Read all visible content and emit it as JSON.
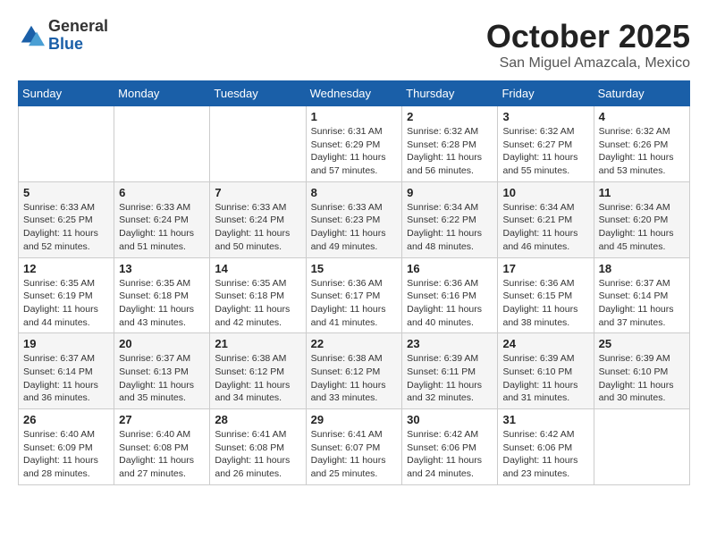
{
  "logo": {
    "general": "General",
    "blue": "Blue"
  },
  "title": "October 2025",
  "location": "San Miguel Amazcala, Mexico",
  "days_of_week": [
    "Sunday",
    "Monday",
    "Tuesday",
    "Wednesday",
    "Thursday",
    "Friday",
    "Saturday"
  ],
  "weeks": [
    [
      {
        "day": "",
        "sunrise": "",
        "sunset": "",
        "daylight": ""
      },
      {
        "day": "",
        "sunrise": "",
        "sunset": "",
        "daylight": ""
      },
      {
        "day": "",
        "sunrise": "",
        "sunset": "",
        "daylight": ""
      },
      {
        "day": "1",
        "sunrise": "Sunrise: 6:31 AM",
        "sunset": "Sunset: 6:29 PM",
        "daylight": "Daylight: 11 hours and 57 minutes."
      },
      {
        "day": "2",
        "sunrise": "Sunrise: 6:32 AM",
        "sunset": "Sunset: 6:28 PM",
        "daylight": "Daylight: 11 hours and 56 minutes."
      },
      {
        "day": "3",
        "sunrise": "Sunrise: 6:32 AM",
        "sunset": "Sunset: 6:27 PM",
        "daylight": "Daylight: 11 hours and 55 minutes."
      },
      {
        "day": "4",
        "sunrise": "Sunrise: 6:32 AM",
        "sunset": "Sunset: 6:26 PM",
        "daylight": "Daylight: 11 hours and 53 minutes."
      }
    ],
    [
      {
        "day": "5",
        "sunrise": "Sunrise: 6:33 AM",
        "sunset": "Sunset: 6:25 PM",
        "daylight": "Daylight: 11 hours and 52 minutes."
      },
      {
        "day": "6",
        "sunrise": "Sunrise: 6:33 AM",
        "sunset": "Sunset: 6:24 PM",
        "daylight": "Daylight: 11 hours and 51 minutes."
      },
      {
        "day": "7",
        "sunrise": "Sunrise: 6:33 AM",
        "sunset": "Sunset: 6:24 PM",
        "daylight": "Daylight: 11 hours and 50 minutes."
      },
      {
        "day": "8",
        "sunrise": "Sunrise: 6:33 AM",
        "sunset": "Sunset: 6:23 PM",
        "daylight": "Daylight: 11 hours and 49 minutes."
      },
      {
        "day": "9",
        "sunrise": "Sunrise: 6:34 AM",
        "sunset": "Sunset: 6:22 PM",
        "daylight": "Daylight: 11 hours and 48 minutes."
      },
      {
        "day": "10",
        "sunrise": "Sunrise: 6:34 AM",
        "sunset": "Sunset: 6:21 PM",
        "daylight": "Daylight: 11 hours and 46 minutes."
      },
      {
        "day": "11",
        "sunrise": "Sunrise: 6:34 AM",
        "sunset": "Sunset: 6:20 PM",
        "daylight": "Daylight: 11 hours and 45 minutes."
      }
    ],
    [
      {
        "day": "12",
        "sunrise": "Sunrise: 6:35 AM",
        "sunset": "Sunset: 6:19 PM",
        "daylight": "Daylight: 11 hours and 44 minutes."
      },
      {
        "day": "13",
        "sunrise": "Sunrise: 6:35 AM",
        "sunset": "Sunset: 6:18 PM",
        "daylight": "Daylight: 11 hours and 43 minutes."
      },
      {
        "day": "14",
        "sunrise": "Sunrise: 6:35 AM",
        "sunset": "Sunset: 6:18 PM",
        "daylight": "Daylight: 11 hours and 42 minutes."
      },
      {
        "day": "15",
        "sunrise": "Sunrise: 6:36 AM",
        "sunset": "Sunset: 6:17 PM",
        "daylight": "Daylight: 11 hours and 41 minutes."
      },
      {
        "day": "16",
        "sunrise": "Sunrise: 6:36 AM",
        "sunset": "Sunset: 6:16 PM",
        "daylight": "Daylight: 11 hours and 40 minutes."
      },
      {
        "day": "17",
        "sunrise": "Sunrise: 6:36 AM",
        "sunset": "Sunset: 6:15 PM",
        "daylight": "Daylight: 11 hours and 38 minutes."
      },
      {
        "day": "18",
        "sunrise": "Sunrise: 6:37 AM",
        "sunset": "Sunset: 6:14 PM",
        "daylight": "Daylight: 11 hours and 37 minutes."
      }
    ],
    [
      {
        "day": "19",
        "sunrise": "Sunrise: 6:37 AM",
        "sunset": "Sunset: 6:14 PM",
        "daylight": "Daylight: 11 hours and 36 minutes."
      },
      {
        "day": "20",
        "sunrise": "Sunrise: 6:37 AM",
        "sunset": "Sunset: 6:13 PM",
        "daylight": "Daylight: 11 hours and 35 minutes."
      },
      {
        "day": "21",
        "sunrise": "Sunrise: 6:38 AM",
        "sunset": "Sunset: 6:12 PM",
        "daylight": "Daylight: 11 hours and 34 minutes."
      },
      {
        "day": "22",
        "sunrise": "Sunrise: 6:38 AM",
        "sunset": "Sunset: 6:12 PM",
        "daylight": "Daylight: 11 hours and 33 minutes."
      },
      {
        "day": "23",
        "sunrise": "Sunrise: 6:39 AM",
        "sunset": "Sunset: 6:11 PM",
        "daylight": "Daylight: 11 hours and 32 minutes."
      },
      {
        "day": "24",
        "sunrise": "Sunrise: 6:39 AM",
        "sunset": "Sunset: 6:10 PM",
        "daylight": "Daylight: 11 hours and 31 minutes."
      },
      {
        "day": "25",
        "sunrise": "Sunrise: 6:39 AM",
        "sunset": "Sunset: 6:10 PM",
        "daylight": "Daylight: 11 hours and 30 minutes."
      }
    ],
    [
      {
        "day": "26",
        "sunrise": "Sunrise: 6:40 AM",
        "sunset": "Sunset: 6:09 PM",
        "daylight": "Daylight: 11 hours and 28 minutes."
      },
      {
        "day": "27",
        "sunrise": "Sunrise: 6:40 AM",
        "sunset": "Sunset: 6:08 PM",
        "daylight": "Daylight: 11 hours and 27 minutes."
      },
      {
        "day": "28",
        "sunrise": "Sunrise: 6:41 AM",
        "sunset": "Sunset: 6:08 PM",
        "daylight": "Daylight: 11 hours and 26 minutes."
      },
      {
        "day": "29",
        "sunrise": "Sunrise: 6:41 AM",
        "sunset": "Sunset: 6:07 PM",
        "daylight": "Daylight: 11 hours and 25 minutes."
      },
      {
        "day": "30",
        "sunrise": "Sunrise: 6:42 AM",
        "sunset": "Sunset: 6:06 PM",
        "daylight": "Daylight: 11 hours and 24 minutes."
      },
      {
        "day": "31",
        "sunrise": "Sunrise: 6:42 AM",
        "sunset": "Sunset: 6:06 PM",
        "daylight": "Daylight: 11 hours and 23 minutes."
      },
      {
        "day": "",
        "sunrise": "",
        "sunset": "",
        "daylight": ""
      }
    ]
  ]
}
